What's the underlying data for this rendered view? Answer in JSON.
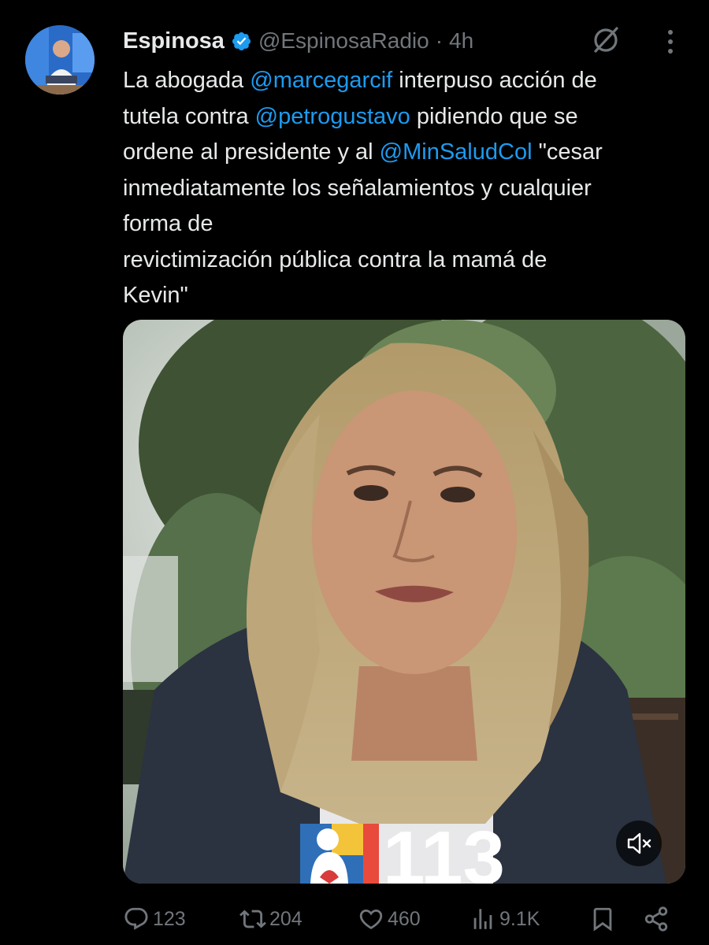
{
  "tweet": {
    "display_name": "Espinosa",
    "handle": "@EspinosaRadio",
    "separator": "·",
    "time": "4h",
    "text_lines": [
      [
        {
          "t": "La abogada "
        },
        {
          "t": "@marcegarcif",
          "mention": true
        },
        {
          "t": " interpuso acción de"
        }
      ],
      [
        {
          "t": "tutela contra "
        },
        {
          "t": "@petrogustavo",
          "mention": true
        },
        {
          "t": " pidiendo que se"
        }
      ],
      [
        {
          "t": "ordene al presidente y al "
        },
        {
          "t": "@MinSaludCol",
          "mention": true
        },
        {
          "t": " \"cesar"
        }
      ],
      [
        {
          "t": "inmediatamente los señalamientos y cualquier"
        }
      ],
      [
        {
          "t": "forma de"
        }
      ],
      [
        {
          "t": "revictimización pública contra la mamá de"
        }
      ],
      [
        {
          "t": "Kevin\""
        }
      ]
    ],
    "media_overlay_text": "113"
  },
  "actions": {
    "replies": "123",
    "reposts": "204",
    "likes": "460",
    "views": "9.1K"
  },
  "icons": {
    "verified": "verified-badge-icon",
    "grok": "grok-icon",
    "more": "more-options-icon",
    "mute": "muted-speaker-icon",
    "reply": "reply-icon",
    "repost": "repost-icon",
    "like": "heart-icon",
    "views": "views-chart-icon",
    "bookmark": "bookmark-icon",
    "share": "share-icon"
  },
  "colors": {
    "background": "#000000",
    "text": "#e7e9ea",
    "muted": "#71767b",
    "link": "#1d9bf0",
    "verified": "#1d9bf0"
  }
}
